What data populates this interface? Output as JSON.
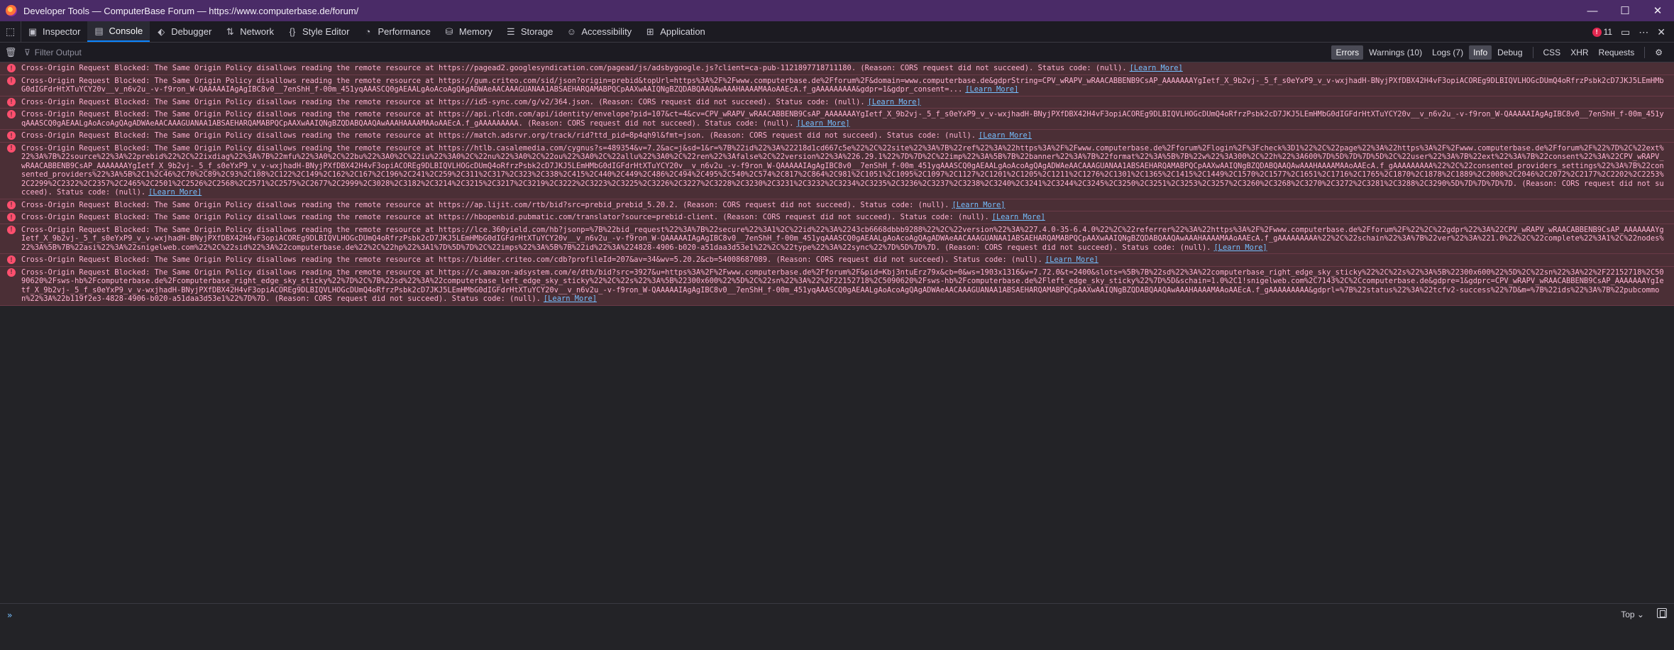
{
  "window": {
    "title": "Developer Tools — ComputerBase Forum — https://www.computerbase.de/forum/",
    "minimize": "—",
    "maximize": "☐",
    "close": "✕"
  },
  "toolbox": {
    "tabs": [
      {
        "label": "Inspector",
        "icon": "inspector-icon"
      },
      {
        "label": "Console",
        "icon": "console-icon"
      },
      {
        "label": "Debugger",
        "icon": "debugger-icon"
      },
      {
        "label": "Network",
        "icon": "network-icon"
      },
      {
        "label": "Style Editor",
        "icon": "style-editor-icon"
      },
      {
        "label": "Performance",
        "icon": "performance-icon"
      },
      {
        "label": "Memory",
        "icon": "memory-icon"
      },
      {
        "label": "Storage",
        "icon": "storage-icon"
      },
      {
        "label": "Accessibility",
        "icon": "accessibility-icon"
      },
      {
        "label": "Application",
        "icon": "application-icon"
      }
    ],
    "error_count": "11",
    "active_tab": "Console"
  },
  "filterbar": {
    "placeholder": "Filter Output",
    "levels": [
      "Errors",
      "Warnings (10)",
      "Logs (7)",
      "Info",
      "Debug"
    ],
    "requests": [
      "CSS",
      "XHR",
      "Requests"
    ]
  },
  "colors": {
    "titlebar": "#4a2b67",
    "error_bg": "#4b2f36",
    "error_text": "#ffb3d2",
    "link": "#75bfff",
    "accent": "#0a84ff"
  },
  "learn_more": "[Learn More]",
  "messages": [
    "Cross-Origin Request Blocked: The Same Origin Policy disallows reading the remote resource at https://pagead2.googlesyndication.com/pagead/js/adsbygoogle.js?client=ca-pub-1121897718711180. (Reason: CORS request did not succeed). Status code: (null).",
    "Cross-Origin Request Blocked: The Same Origin Policy disallows reading the remote resource at https://gum.criteo.com/sid/json?origin=prebid&topUrl=https%3A%2F%2Fwww.computerbase.de%2Fforum%2F&domain=www.computerbase.de&gdprString=CPV_wRAPV_wRAACABBENB9CsAP_AAAAAAAYgIetf_X_9b2vj-_5_f_s0eYxP9_v_v-wxjhadH-BNyjPXfDBX42H4vF3opiACOREg9DLBIQVLHOGcDUmQ4oRfrzPsbk2cD7JKJ5LEmHMbG0dIGFdrHtXTuYCY20v__v_n6v2u_-v-f9ron_W-QAAAAAIAgAgIBC8v0__7enShH_f-00m_451yqAAASCQ0gAEAALgAoAcoAgQAgADWAeAACAAAGUANAA1ABSAEHARQAMABPQCpAAXwAAIQNgBZQDABQAAQAwAAAHAAAAMAAoAAEcA.f_gAAAAAAAAA&gdpr=1&gdpr_consent=...",
    "Cross-Origin Request Blocked: The Same Origin Policy disallows reading the remote resource at https://id5-sync.com/g/v2/364.json. (Reason: CORS request did not succeed). Status code: (null).",
    "Cross-Origin Request Blocked: The Same Origin Policy disallows reading the remote resource at https://api.rlcdn.com/api/identity/envelope?pid=107&ct=4&cv=CPV_wRAPV_wRAACABBENB9CsAP_AAAAAAAYgIetf_X_9b2vj-_5_f_s0eYxP9_v_v-wxjhadH-BNyjPXfDBX42H4vF3opiACOREg9DLBIQVLHOGcDUmQ4oRfrzPsbk2cD7JKJ5LEmHMbG0dIGFdrHtXTuYCY20v__v_n6v2u_-v-f9ron_W-QAAAAAIAgAgIBC8v0__7enShH_f-00m_451yqAAASCQ0gAEAALgAoAcoAgQAgADWAeAACAAAGUANAA1ABSAEHARQAMABPQCpAAXwAAIQNgBZQDABQAAQAwAAAHAAAAMAAoAAEcA.f_gAAAAAAAAA. (Reason: CORS request did not succeed). Status code: (null).",
    "Cross-Origin Request Blocked: The Same Origin Policy disallows reading the remote resource at https://match.adsrvr.org/track/rid?ttd_pid=8p4qh9l&fmt=json. (Reason: CORS request did not succeed). Status code: (null).",
    "Cross-Origin Request Blocked: The Same Origin Policy disallows reading the remote resource at https://htlb.casalemedia.com/cygnus?s=489354&v=7.2&ac=j&sd=1&r=%7B%22id%22%3A%22218d1cd667c5e%22%2C%22site%22%3A%7B%22ref%22%3A%22https%3A%2F%2Fwww.computerbase.de%2Fforum%2Flogin%2F%3Fcheck%3D1%22%2C%22page%22%3A%22https%3A%2F%2Fwww.computerbase.de%2Fforum%2F%22%7D%2C%22ext%22%3A%7B%22source%22%3A%22prebid%22%2C%22ixdiag%22%3A%7B%22mfu%22%3A0%2C%22bu%22%3A0%2C%22iu%22%3A0%2C%22nu%22%3A0%2C%22ou%22%3A0%2C%22allu%22%3A0%2C%22ren%22%3Afalse%2C%22version%22%3A%226.29.1%22%7D%7D%2C%22imp%22%3A%5B%7B%22banner%22%3A%7B%22format%22%3A%5B%7B%22w%22%3A300%2C%22h%22%3A600%7D%5D%7D%7D%5D%2C%22user%22%3A%7B%22ext%22%3A%7B%22consent%22%3A%22CPV_wRAPV_wRAACABBENB9CsAP_AAAAAAAYgIetf_X_9b2vj-_5_f_s0eYxP9_v_v-wxjhadH-BNyjPXfDBX42H4vF3opiACOREg9DLBIQVLHOGcDUmQ4oRfrzPsbk2cD7JKJ5LEmHMbG0dIGFdrHtXTuYCY20v__v_n6v2u_-v-f9ron_W-QAAAAAIAgAgIBC8v0__7enShH_f-00m_451yqAAASCQ0gAEAALgAoAcoAgQAgADWAeAACAAAGUANAA1ABSAEHARQAMABPQCpAAXwAAIQNgBZQDABQAAQAwAAAHAAAAMAAoAAEcA.f_gAAAAAAAAA%22%2C%22consented_providers_settings%22%3A%7B%22consented_providers%22%3A%5B%2C1%2C46%2C70%2C89%2C93%2C108%2C122%2C149%2C162%2C167%2C196%2C241%2C259%2C311%2C317%2C323%2C338%2C415%2C440%2C449%2C486%2C494%2C495%2C540%2C574%2C817%2C864%2C981%2C1051%2C1095%2C1097%2C1127%2C1201%2C1205%2C1211%2C1276%2C1301%2C1365%2C1415%2C1449%2C1570%2C1577%2C1651%2C1716%2C1765%2C1870%2C1878%2C1889%2C2008%2C2046%2C2072%2C2177%2C2202%2C2253%2C2299%2C2322%2C2357%2C2465%2C2501%2C2526%2C2568%2C2571%2C2575%2C2677%2C2999%2C3028%2C3182%2C3214%2C3215%2C3217%2C3219%2C3222%2C3223%2C3225%2C3226%2C3227%2C3228%2C3230%2C3231%2C3232%2C3234%2C3235%2C3236%2C3237%2C3238%2C3240%2C3241%2C3244%2C3245%2C3250%2C3251%2C3253%2C3257%2C3260%2C3268%2C3270%2C3272%2C3281%2C3288%2C3290%5D%7D%7D%7D%7D. (Reason: CORS request did not succeed). Status code: (null).",
    "Cross-Origin Request Blocked: The Same Origin Policy disallows reading the remote resource at https://ap.lijit.com/rtb/bid?src=prebid_prebid_5.20.2. (Reason: CORS request did not succeed). Status code: (null).",
    "Cross-Origin Request Blocked: The Same Origin Policy disallows reading the remote resource at https://hbopenbid.pubmatic.com/translator?source=prebid-client. (Reason: CORS request did not succeed). Status code: (null).",
    "Cross-Origin Request Blocked: The Same Origin Policy disallows reading the remote resource at https://lce.360yield.com/hb?jsonp=%7B%22bid_request%22%3A%7B%22secure%22%3A1%2C%22id%22%3A%2243cb6668dbbb9288%22%2C%22version%22%3A%227.4.0-35-6.4.0%22%2C%22referrer%22%3A%22https%3A%2F%2Fwww.computerbase.de%2Fforum%2F%22%2C%22gdpr%22%3A%22CPV_wRAPV_wRAACABBENB9CsAP_AAAAAAAYgIetf_X_9b2vj-_5_f_s0eYxP9_v_v-wxjhadH-BNyjPXfDBX42H4vF3opiACOREg9DLBIQVLHOGcDUmQ4oRfrzPsbk2cD7JKJ5LEmHMbG0dIGFdrHtXTuYCY20v__v_n6v2u_-v-f9ron_W-QAAAAAIAgAgIBC8v0__7enShH_f-00m_451yqAAASCQ0gAEAALgAoAcoAgQAgADWAeAACAAAGUANAA1ABSAEHARQAMABPQCpAAXwAAIQNgBZQDABQAAQAwAAAHAAAAMAAoAAEcA.f_gAAAAAAAAA%22%2C%22schain%22%3A%7B%22ver%22%3A%221.0%22%2C%22complete%22%3A1%2C%22nodes%22%3A%5B%7B%22asi%22%3A%22snigelweb.com%22%2C%22sid%22%3A%22computerbase.de%22%2C%22hp%22%3A1%7D%5D%7D%2C%22imps%22%3A%5B%7B%22id%22%3A%224828-4906-b020-a51daa3d53e1%22%2C%22type%22%3A%22sync%22%7D%5D%7D%7D. (Reason: CORS request did not succeed). Status code: (null).",
    "Cross-Origin Request Blocked: The Same Origin Policy disallows reading the remote resource at https://bidder.criteo.com/cdb?profileId=207&av=34&wv=5.20.2&cb=54008687089. (Reason: CORS request did not succeed). Status code: (null).",
    "Cross-Origin Request Blocked: The Same Origin Policy disallows reading the remote resource at https://c.amazon-adsystem.com/e/dtb/bid?src=3927&u=https%3A%2F%2Fwww.computerbase.de%2Fforum%2F&pid=Kbj3ntuErz79x&cb=0&ws=1903x1316&v=7.72.0&t=2400&slots=%5B%7B%22sd%22%3A%22computerbase_right_edge_sky_sticky%22%2C%22s%22%3A%5B%22300x600%22%5D%2C%22sn%22%3A%22%2F22152718%2C5090620%2Fsws-hb%2Fcomputerbase.de%2Fcomputerbase_right_edge_sky_sticky%22%7D%2C%7B%22sd%22%3A%22computerbase_left_edge_sky_sticky%22%2C%22s%22%3A%5B%22300x600%22%5D%2C%22sn%22%3A%22%2F22152718%2C5090620%2Fsws-hb%2Fcomputerbase.de%2Fleft_edge_sky_sticky%22%7D%5D&schain=1.0%2C1!snigelweb.com%2C7143%2C%2Ccomputerbase.de&gdpre=1&gdprc=CPV_wRAPV_wRAACABBENB9CsAP_AAAAAAAYgIetf_X_9b2vj-_5_f_s0eYxP9_v_v-wxjhadH-BNyjPXfDBX42H4vF3opiACOREg9DLBIQVLHOGcDUmQ4oRfrzPsbk2cD7JKJ5LEmHMbG0dIGFdrHtXTuYCY20v__v_n6v2u_-v-f9ron_W-QAAAAAIAgAgIBC8v0__7enShH_f-00m_451yqAAASCQ0gAEAALgAoAcoAgQAgADWAeAACAAAGUANAA1ABSAEHARQAMABPQCpAAXwAAIQNgBZQDABQAAQAwAAAHAAAAMAAoAAEcA.f_gAAAAAAAAA&gdprl=%7B%22status%22%3A%22tcfv2-success%22%7D&m=%7B%22ids%22%3A%7B%22pubcommon%22%3A%22b119f2e3-4828-4906-b020-a51daa3d53e1%22%7D%7D. (Reason: CORS request did not succeed). Status code: (null)."
  ],
  "commandline": {
    "prompt": "»",
    "context": "Top ⌄"
  }
}
